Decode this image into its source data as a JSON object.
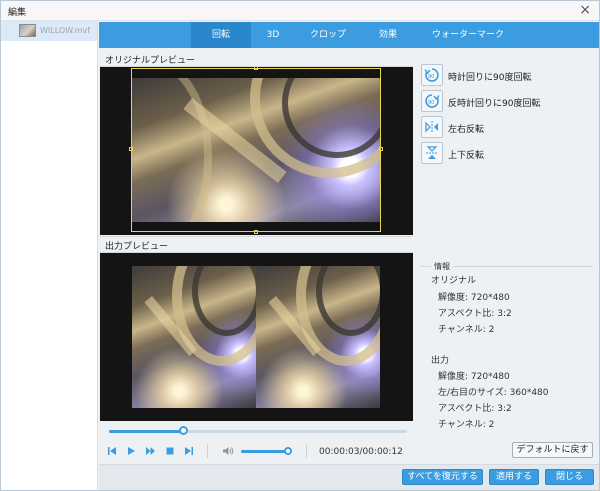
{
  "window": {
    "title": "編集",
    "close_icon": "×"
  },
  "sidebar": {
    "files": [
      {
        "name": "WILLOW.mvf",
        "thumb_icon": "video-thumbnail"
      }
    ]
  },
  "tabs": [
    {
      "label": "回転",
      "active": true
    },
    {
      "label": "3D",
      "active": false
    },
    {
      "label": "クロップ",
      "active": false
    },
    {
      "label": "効果",
      "active": false
    },
    {
      "label": "ウォーターマーク",
      "active": false
    }
  ],
  "original_preview": {
    "label": "オリジナルプレビュー"
  },
  "output_preview": {
    "label": "出力プレビュー"
  },
  "rotate_actions": [
    {
      "label": "時計回りに90度回転",
      "icon": "rotate-clockwise-icon"
    },
    {
      "label": "反時計回りに90度回転",
      "icon": "rotate-counterclockwise-icon"
    },
    {
      "label": "左右反転",
      "icon": "flip-horizontal-icon"
    },
    {
      "label": "上下反転",
      "icon": "flip-vertical-icon"
    }
  ],
  "info": {
    "caption": "情報",
    "original_heading": "オリジナル",
    "original": {
      "resolution": "解像度: 720*480",
      "aspect": "アスペクト比: 3:2",
      "channels": "チャンネル: 2"
    },
    "output_heading": "出力",
    "output": {
      "resolution": "解像度: 720*480",
      "eye_size": "左/右目のサイズ: 360*480",
      "aspect": "アスペクト比: 3:2",
      "channels": "チャンネル: 2"
    }
  },
  "buttons": {
    "reset_default": "デフォルトに戻す",
    "restore_all": "すべてを復元する",
    "apply": "適用する",
    "close": "閉じる"
  },
  "player": {
    "progress_fraction": 0.25,
    "volume_fraction": 0.95,
    "timecode": "00:00:03/00:00:12",
    "icons": [
      "skip-back-icon",
      "play-icon",
      "fast-forward-icon",
      "stop-icon",
      "skip-forward-icon",
      "volume-icon"
    ]
  },
  "colors": {
    "accent": "#3b9de0",
    "selection": "#e8d34a"
  }
}
